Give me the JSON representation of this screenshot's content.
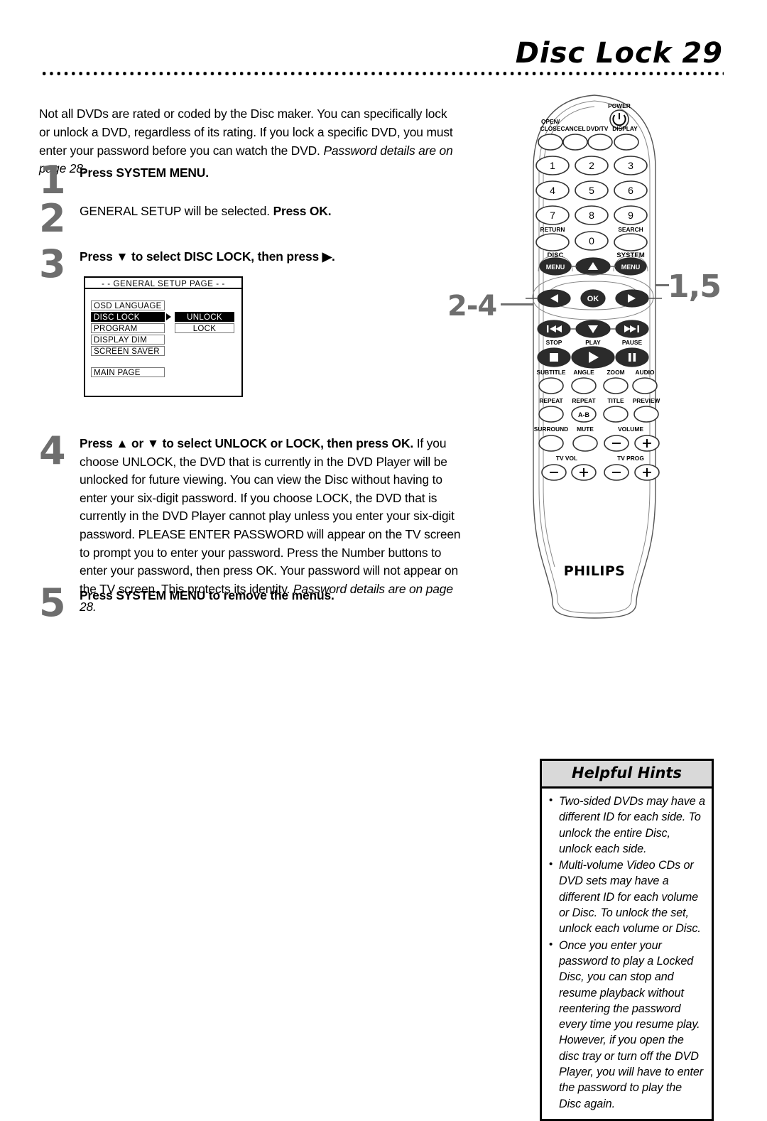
{
  "header": {
    "title": "Disc Lock",
    "page_number": "29"
  },
  "intro": {
    "text_normal": "Not all DVDs are rated or coded by the Disc maker. You can specifically lock or unlock a DVD, regardless of its rating. If you lock a specific DVD, you must enter your password before you can watch the DVD. ",
    "text_italic": "Password details are on page 28."
  },
  "steps": [
    {
      "number": "1",
      "bold": "Press SYSTEM MENU.",
      "normal": ""
    },
    {
      "number": "2",
      "normal_lead": "GENERAL SETUP will be selected. ",
      "bold": "Press OK."
    },
    {
      "number": "3",
      "bold": "Press ▼ to select DISC LOCK, then press ▶."
    },
    {
      "number": "4",
      "bold": "Press ▲ or ▼ to select UNLOCK or LOCK, then press OK.",
      "normal": " If you choose UNLOCK, the DVD that is currently in the DVD Player will be unlocked for future viewing. You can view the Disc without having to enter your six-digit password. If you choose LOCK, the DVD that is currently in the DVD Player cannot play unless you enter your six-digit password. PLEASE ENTER PASSWORD will appear on the TV screen to prompt you to enter your password. Press the Number buttons to enter your password, then press OK.  Your password will not appear on the TV screen. This protects its identity. ",
      "italic_tail": "Password details are on page 28."
    },
    {
      "number": "5",
      "bold": "Press SYSTEM MENU",
      "normal": " to remove the menus."
    }
  ],
  "osd_menu": {
    "title": "- -  GENERAL SETUP PAGE  - -",
    "items": [
      {
        "label": "OSD LANGUAGE",
        "selected": false
      },
      {
        "label": "DISC LOCK",
        "selected": true
      },
      {
        "label": "PROGRAM",
        "selected": false
      },
      {
        "label": "DISPLAY DIM",
        "selected": false
      },
      {
        "label": "SCREEN SAVER",
        "selected": false
      }
    ],
    "main_page": "MAIN PAGE",
    "options": [
      {
        "label": "UNLOCK",
        "selected": true
      },
      {
        "label": "LOCK",
        "selected": false
      }
    ]
  },
  "callouts": {
    "left": "2-4",
    "right": "1,5"
  },
  "remote": {
    "brand": "PHILIPS",
    "power_label": "POWER",
    "top_row": [
      "OPEN/ CLOSE",
      "CANCEL",
      "DVD/TV",
      "DISPLAY"
    ],
    "open_close_line1": "OPEN/",
    "open_close_line2": "CLOSE",
    "cancel": "CANCEL",
    "dvd_tv": "DVD/TV",
    "display": "DISPLAY",
    "numbers": [
      "1",
      "2",
      "3",
      "4",
      "5",
      "6",
      "7",
      "8",
      "9",
      "0"
    ],
    "return_label": "RETURN",
    "search_label": "SEARCH",
    "disc_label": "DISC",
    "system_label": "SYSTEM",
    "menu_label": "MENU",
    "ok_label": "OK",
    "stop_label": "STOP",
    "play_label": "PLAY",
    "pause_label": "PAUSE",
    "subtitle_label": "SUBTITLE",
    "angle_label": "ANGLE",
    "zoom_label": "ZOOM",
    "audio_label": "AUDIO",
    "repeat_label": "REPEAT",
    "repeat_ab_label": "REPEAT",
    "repeat_ab_button": "A-B",
    "title_label": "TITLE",
    "preview_label": "PREVIEW",
    "surround_label": "SURROUND",
    "mute_label": "MUTE",
    "volume_label": "VOLUME",
    "tv_vol_label": "TV VOL",
    "tv_prog_label": "TV PROG",
    "minus": "−",
    "plus": "+"
  },
  "hints": {
    "title": "Helpful Hints",
    "items": [
      "Two-sided DVDs may have a different ID for each side. To unlock the entire Disc, unlock each side.",
      "Multi-volume Video CDs or DVD sets may have a different ID for each volume or Disc. To unlock the set, unlock each volume or Disc.",
      "Once you enter your password to play a Locked Disc, you can stop and resume playback without reentering the password every time you resume play. However, if you open the disc tray or turn off the DVD Player, you will have to enter the password to play the Disc again."
    ]
  },
  "colors": {
    "step_number_gray": "#6e6e6e",
    "hints_header_gray": "#d9d9d9",
    "selected_black": "#000000"
  }
}
